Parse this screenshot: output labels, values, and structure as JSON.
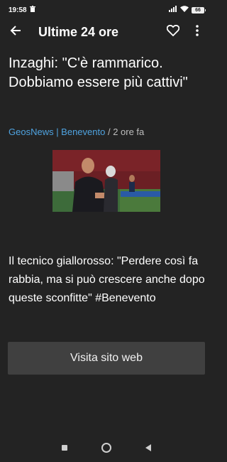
{
  "status_bar": {
    "time": "19:58",
    "battery": "66",
    "icons": [
      "trash-icon",
      "signal-icon",
      "wifi-icon",
      "battery-icon"
    ]
  },
  "app_bar": {
    "title": "Ultime 24 ore",
    "icons": [
      "back-arrow-icon",
      "heart-icon",
      "more-vert-icon"
    ]
  },
  "article": {
    "headline": "Inzaghi: \"C'è rammarico. Dobbiamo essere più cattivi\"",
    "source": "GeosNews | Benevento",
    "separator": " / ",
    "time_ago": "2 ore fa",
    "body": "Il tecnico giallorosso: \"Perdere così fa rabbia, ma si può crescere anche dopo queste sconfitte\" #Benevento",
    "visit_button": "Visita sito web"
  },
  "colors": {
    "background": "#232323",
    "link": "#4fa3e0",
    "button": "#404040"
  }
}
